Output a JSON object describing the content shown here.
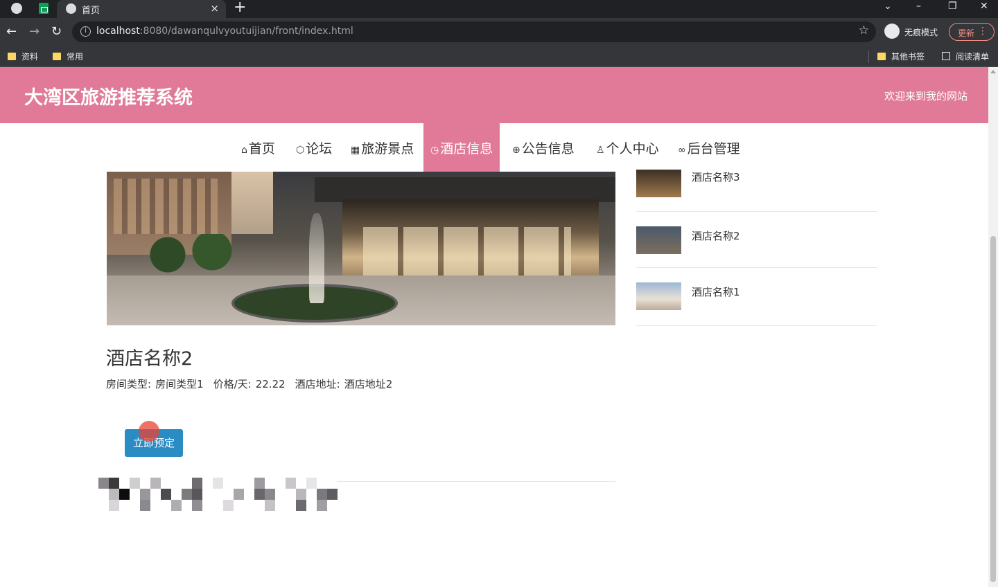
{
  "browser": {
    "tab_title": "首页",
    "tab_close": "×",
    "new_tab": "+",
    "url_host": "localhost",
    "url_rest": ":8080/dawanqulvyoutuijian/front/index.html",
    "incognito_label": "无痕模式",
    "update_label": "更新",
    "bookmarks": [
      "资料",
      "常用"
    ],
    "other_bookmarks": "其他书签",
    "reading_list": "阅读清单"
  },
  "header": {
    "title": "大湾区旅游推荐系统",
    "welcome": "欢迎来到我的网站",
    "accent_color": "#e07a98"
  },
  "menu": [
    {
      "label": "首页",
      "icon": "home-icon"
    },
    {
      "label": "论坛",
      "icon": "cube-icon"
    },
    {
      "label": "旅游景点",
      "icon": "gift-icon"
    },
    {
      "label": "酒店信息",
      "icon": "clock-icon"
    },
    {
      "label": "公告信息",
      "icon": "globe-icon"
    },
    {
      "label": "个人中心",
      "icon": "user-icon"
    },
    {
      "label": "后台管理",
      "icon": "link-icon"
    }
  ],
  "active_menu": "酒店信息",
  "detail": {
    "name": "酒店名称2",
    "room_type_label": "房间类型:",
    "room_type_value": "房间类型1",
    "price_label": "价格/天:",
    "price_value": "22.22",
    "address_label": "酒店地址:",
    "address_value": "酒店地址2",
    "book_button": "立即预定"
  },
  "sidebar": [
    {
      "name": "酒店名称3"
    },
    {
      "name": "酒店名称2"
    },
    {
      "name": "酒店名称1"
    }
  ]
}
